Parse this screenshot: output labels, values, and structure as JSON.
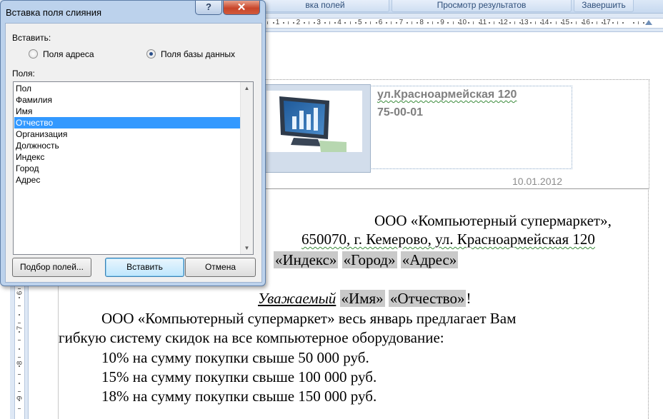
{
  "ribbon": {
    "buttons": [
      "вка полей",
      "Просмотр результатов",
      "Завершить"
    ]
  },
  "ruler": {
    "numbers": [
      "1",
      "2",
      "3",
      "4",
      "5",
      "6",
      "7",
      "8",
      "9",
      "10",
      "11",
      "12",
      "13",
      "14",
      "15",
      "16",
      "17"
    ],
    "vertical_numbers": [
      "6",
      "7",
      "8",
      "9"
    ]
  },
  "document": {
    "header": {
      "address": "ул.Красноармейская 120",
      "phone": "75-00-01",
      "date": "10.01.2012"
    },
    "recipient_line1": "ООО «Компьютерный супермаркет»,",
    "recipient_line2": "650070, г. Кемерово, ул. Красноармейская 120",
    "field_index": "«Индекс»",
    "field_city": "«Город»",
    "field_address": "«Адрес»",
    "greeting_word": "Уважаемый",
    "field_name": "«Имя»",
    "field_patronymic": "«Отчество»",
    "greeting_end": "!",
    "para_line1": "ООО «Компьютерный супермаркет» весь январь предлагает Вам",
    "para_line2": "гибкую систему скидок на все компьютерное оборудование:",
    "discounts": [
      "10% на сумму покупки свыше 50 000 руб.",
      "15% на сумму покупки свыше 100 000 руб.",
      "18% на сумму покупки свыше 150 000 руб."
    ]
  },
  "dialog": {
    "title": "Вставка поля слияния",
    "help_label": "?",
    "close_label": "✕",
    "insert_label": "Вставить:",
    "radio_address": "Поля адреса",
    "radio_db": "Поля базы данных",
    "radio_selected": "db",
    "fields_label": "Поля:",
    "fields": [
      "Пол",
      "Фамилия",
      "Имя",
      "Отчество",
      "Организация",
      "Должность",
      "Индекс",
      "Город",
      "Адрес"
    ],
    "selected_field": "Отчество",
    "buttons": {
      "match": "Подбор полей...",
      "insert": "Вставить",
      "cancel": "Отмена"
    }
  },
  "colors": {
    "selection": "#3399ff",
    "field_shading": "#c9c9c9",
    "dialog_frame": "#bcd2ec"
  }
}
